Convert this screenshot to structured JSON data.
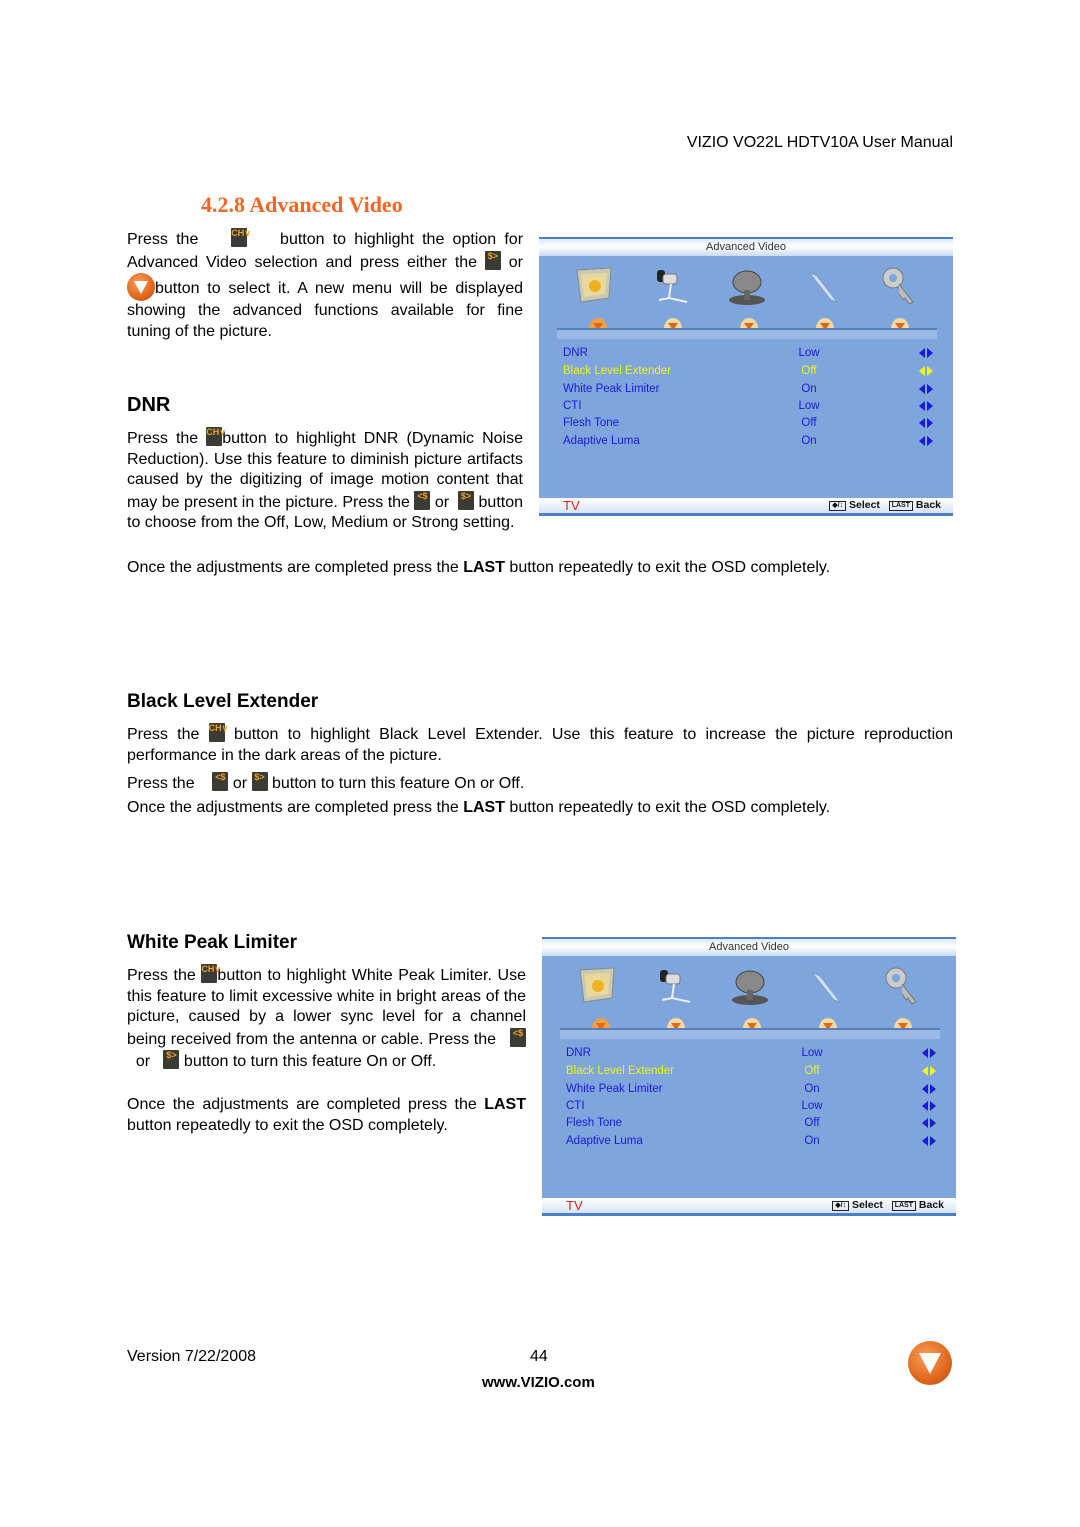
{
  "header": {
    "title": "VIZIO VO22L HDTV10A User Manual"
  },
  "section": {
    "title": "4.2.8 Advanced Video"
  },
  "intro": {
    "t1": "Press the",
    "t2": "button to highlight the option for Advanced Video selection and press either the",
    "t3": "or",
    "t4": "button to select it.  A new menu will be displayed showing the advanced functions available for fine tuning of the picture."
  },
  "icons": {
    "ch_down": "ch-down-button-icon",
    "vol_left": "volume-down-button-icon",
    "vol_right": "volume-up-button-icon",
    "menu_v": "vizio-menu-button-icon",
    "ch_glyph": "CH∨",
    "left_glyph": "<$",
    "right_glyph": "$>"
  },
  "dnr": {
    "heading": "DNR",
    "p1a": "Press the",
    "p1b": "button to highlight DNR (Dynamic Noise Reduction).  Use this feature to diminish picture artifacts caused by the digitizing of image motion content that may be present in the picture.",
    "p2a": "Press the",
    "p2b": "or",
    "p2c": "button to choose from the Off, Low, Medium or Strong setting.",
    "p3a": "Once the adjustments are completed press the",
    "p3b": "LAST",
    "p3c": "button repeatedly to exit the OSD completely."
  },
  "ble": {
    "heading": "Black Level Extender",
    "p1a": "Press the",
    "p1b": "button to highlight Black Level Extender.  Use this feature to increase the picture reproduction performance in the dark areas of the picture.",
    "p2a": "Press the",
    "p2b": "or",
    "p2c": "button to turn this feature On or Off.",
    "p3a": "Once the adjustments are completed press the",
    "p3b": "LAST",
    "p3c": "button repeatedly to exit the OSD completely."
  },
  "wpl": {
    "heading": "White Peak Limiter",
    "p1a": "Press the",
    "p1b": "button to highlight White Peak Limiter. Use this feature to limit excessive white in bright areas of the picture, caused by a lower sync level for a channel being received from the antenna or cable.  Press the",
    "p1c": "or",
    "p1d": "button to turn this feature On or Off.",
    "p2a": "Once the adjustments are completed press the",
    "p2b": "LAST",
    "p2c": "button repeatedly to exit the OSD completely."
  },
  "osd": {
    "title": "Advanced Video",
    "tab_icons": [
      "picture-icon",
      "audio-microphone-icon",
      "satellite-dish-tv-icon",
      "wrench-setup-icon",
      "key-parental-icon"
    ],
    "rows": [
      {
        "label": "DNR",
        "value": "Low",
        "selected": false
      },
      {
        "label": "Black Level Extender",
        "value": "Off",
        "selected": true
      },
      {
        "label": "White Peak Limiter",
        "value": "On",
        "selected": false
      },
      {
        "label": "CTI",
        "value": "Low",
        "selected": false
      },
      {
        "label": "Flesh Tone",
        "value": "Off",
        "selected": false
      },
      {
        "label": "Adaptive Luma",
        "value": "On",
        "selected": false
      }
    ],
    "source": "TV",
    "nav_key": "◆/↕",
    "select_label": "Select",
    "last_key": "LAST",
    "back_label": "Back",
    "colors": {
      "bg": "#7ea6dc",
      "item": "#1a1ad8",
      "selected": "#f2f21a",
      "source": "#e02020"
    }
  },
  "footer": {
    "version": "Version 7/22/2008",
    "page": "44",
    "url": "www.VIZIO.com"
  }
}
